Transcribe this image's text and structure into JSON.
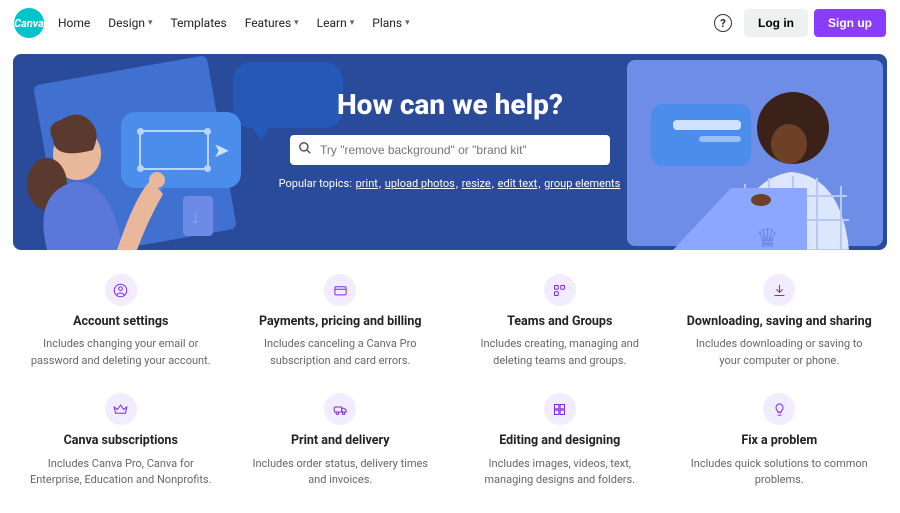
{
  "brand": "Canva",
  "nav": [
    "Home",
    "Design",
    "Templates",
    "Features",
    "Learn",
    "Plans"
  ],
  "nav_dropdown": [
    false,
    true,
    false,
    true,
    true,
    true
  ],
  "header": {
    "login": "Log in",
    "signup": "Sign up"
  },
  "hero": {
    "title": "How can we help?",
    "search_placeholder": "Try \"remove background\" or \"brand kit\"",
    "popular_label": "Popular topics:",
    "popular_links": [
      "print",
      "upload photos",
      "resize",
      "edit text",
      "group elements"
    ]
  },
  "topics": [
    {
      "id": "account-settings",
      "icon": "user-circle-icon",
      "title": "Account settings",
      "desc": "Includes changing your email or password and deleting your account."
    },
    {
      "id": "payments",
      "icon": "credit-card-icon",
      "title": "Payments, pricing and billing",
      "desc": "Includes canceling a Canva Pro subscription and card errors."
    },
    {
      "id": "teams-groups",
      "icon": "teams-icon",
      "title": "Teams and Groups",
      "desc": "Includes creating, managing and deleting teams and groups."
    },
    {
      "id": "downloading",
      "icon": "download-icon",
      "title": "Downloading, saving and sharing",
      "desc": "Includes downloading or saving to your computer or phone."
    },
    {
      "id": "subscriptions",
      "icon": "crown-icon",
      "title": "Canva subscriptions",
      "desc": "Includes Canva Pro, Canva for Enterprise, Education and Nonprofits."
    },
    {
      "id": "print-delivery",
      "icon": "truck-icon",
      "title": "Print and delivery",
      "desc": "Includes order status, delivery times and invoices."
    },
    {
      "id": "editing-designing",
      "icon": "grid-icon",
      "title": "Editing and designing",
      "desc": "Includes images, videos, text, managing designs and folders."
    },
    {
      "id": "fix-problem",
      "icon": "lightbulb-icon",
      "title": "Fix a problem",
      "desc": "Includes quick solutions to common problems."
    }
  ]
}
